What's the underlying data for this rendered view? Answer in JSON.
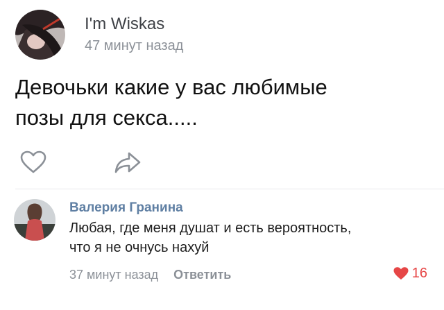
{
  "post": {
    "author_name": "I'm Wiskas",
    "time": "47 минут назад",
    "text_line_1": "Девочьки какие у вас любимые",
    "text_line_2": "позы для секса.....",
    "actions": {
      "like_icon": "heart-outline-icon",
      "share_icon": "share-arrow-icon"
    }
  },
  "comment": {
    "author_name": "Валерия Гранина",
    "text_line_1": "Любая, где меня душат и есть вероятность,",
    "text_line_2": "что я не очнусь нахуй",
    "time": "37 минут назад",
    "reply_label": "Ответить",
    "like_count": "16",
    "like_icon": "heart-filled-icon"
  },
  "colors": {
    "link_blue": "#5f7fa3",
    "secondary_gray": "#8b9097",
    "like_red": "#e64646"
  }
}
